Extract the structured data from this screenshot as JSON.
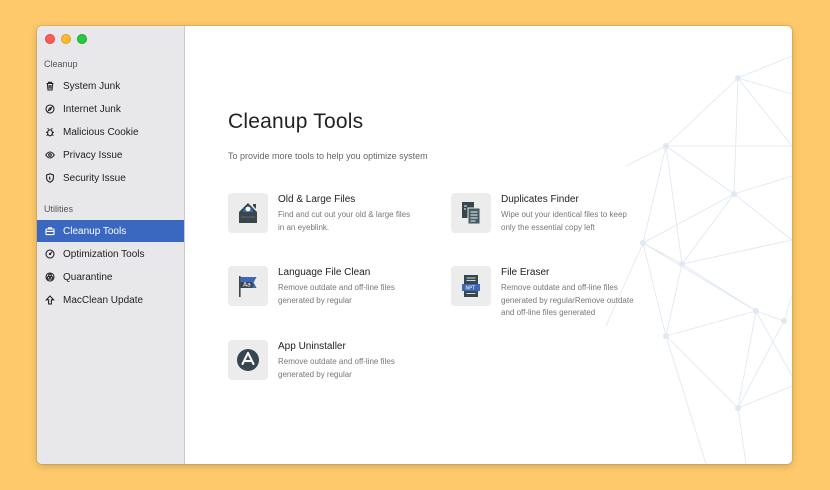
{
  "sidebar": {
    "section_cleanup": "Cleanup",
    "section_utilities": "Utilities",
    "cleanup_items": [
      {
        "label": "System Junk",
        "icon": "trash-icon"
      },
      {
        "label": "Internet Junk",
        "icon": "compass-icon"
      },
      {
        "label": "Malicious Cookie",
        "icon": "bug-icon"
      },
      {
        "label": "Privacy Issue",
        "icon": "eye-icon"
      },
      {
        "label": "Security Issue",
        "icon": "shield-icon"
      }
    ],
    "utility_items": [
      {
        "label": "Cleanup Tools",
        "icon": "briefcase-icon",
        "active": true
      },
      {
        "label": "Optimization Tools",
        "icon": "gauge-icon"
      },
      {
        "label": "Quarantine",
        "icon": "biohazard-icon"
      },
      {
        "label": "MacClean Update",
        "icon": "arrow-up-icon"
      }
    ]
  },
  "main": {
    "title": "Cleanup Tools",
    "subtitle": "To provide more tools to help you optimize system",
    "tools": [
      {
        "name": "Old & Large Files",
        "desc": "Find and cut out your old & large files in an eyeblink.",
        "icon": "old-large-files-icon"
      },
      {
        "name": "Duplicates Finder",
        "desc": "Wipe out your identical files to keep only the essential copy left",
        "icon": "duplicates-icon"
      },
      {
        "name": "Language File Clean",
        "desc": "Remove outdate and off-line files generated by regular",
        "icon": "language-flag-icon"
      },
      {
        "name": "File Eraser",
        "desc": "Remove outdate and off-line files generated by regularRemove outdate and off-line files generated",
        "icon": "file-eraser-icon"
      },
      {
        "name": "App Uninstaller",
        "desc": "Remove outdate and off-line files generated by regular",
        "icon": "app-store-icon"
      }
    ],
    "flag_text": "Aa",
    "eraser_text": "NPT"
  },
  "colors": {
    "background": "#fdc96a",
    "sidebar": "#e8e7ea",
    "accent": "#3a67c0",
    "icon_dark": "#37474f",
    "icon_blue": "#3f67b8"
  }
}
